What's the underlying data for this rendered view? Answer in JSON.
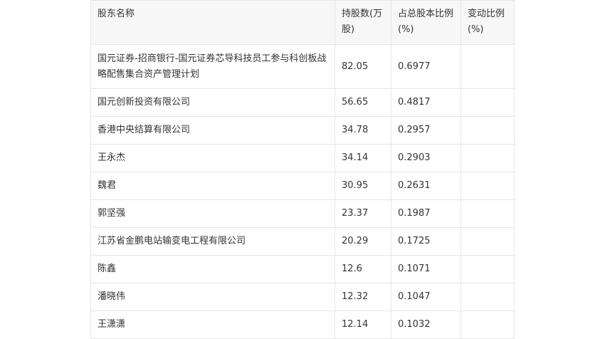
{
  "headers": [
    "股东名称",
    "持股数(万股)",
    "占总股本比例(%)",
    "变动比例(%)"
  ],
  "rows": [
    {
      "name": "国元证券-招商银行-国元证券芯导科技员工参与科创板战略配售集合资产管理计划",
      "shares": "82.05",
      "ratio": "0.6977",
      "change": ""
    },
    {
      "name": "国元创新投资有限公司",
      "shares": "56.65",
      "ratio": "0.4817",
      "change": ""
    },
    {
      "name": "香港中央结算有限公司",
      "shares": "34.78",
      "ratio": "0.2957",
      "change": ""
    },
    {
      "name": "王永杰",
      "shares": "34.14",
      "ratio": "0.2903",
      "change": ""
    },
    {
      "name": "魏君",
      "shares": "30.95",
      "ratio": "0.2631",
      "change": ""
    },
    {
      "name": "郭坚强",
      "shares": "23.37",
      "ratio": "0.1987",
      "change": ""
    },
    {
      "name": "江苏省金鹏电站输变电工程有限公司",
      "shares": "20.29",
      "ratio": "0.1725",
      "change": ""
    },
    {
      "name": "陈鑫",
      "shares": "12.6",
      "ratio": "0.1071",
      "change": ""
    },
    {
      "name": "潘晓伟",
      "shares": "12.32",
      "ratio": "0.1047",
      "change": ""
    },
    {
      "name": "王潇潇",
      "shares": "12.14",
      "ratio": "0.1032",
      "change": ""
    }
  ]
}
